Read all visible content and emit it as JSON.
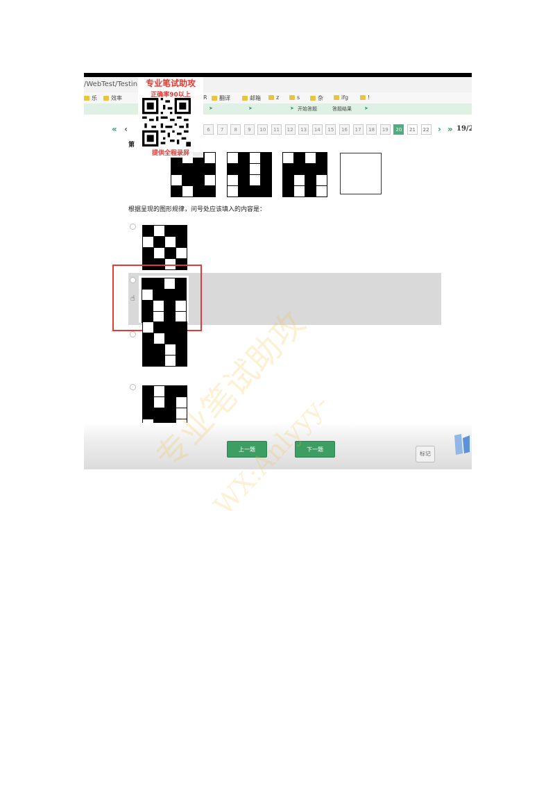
{
  "browser": {
    "url_fragment": "/WebTest/Testin",
    "bookmarks": [
      "乐",
      "效率",
      "R",
      "翻译",
      "邮箱",
      "z",
      "s",
      "杂",
      "ifg",
      "!"
    ]
  },
  "steps": {
    "items": [
      "开始答题",
      "答题结果"
    ]
  },
  "pager": {
    "pages": [
      "6",
      "7",
      "8",
      "9",
      "10",
      "11",
      "12",
      "13",
      "14",
      "15",
      "16",
      "17",
      "18",
      "19",
      "20",
      "21",
      "22"
    ],
    "current": "20",
    "counter": "19/2",
    "prefix": "第"
  },
  "promo": {
    "title": "专业笔试助攻",
    "line2": "正确率90以上",
    "line3": "提供全程录屏"
  },
  "question": {
    "text": "根据呈现的图形规律，问号处应该填入的内容是："
  },
  "buttons": {
    "prev": "上一题",
    "next": "下一题",
    "mark": "标记"
  },
  "watermark": {
    "line1": "专业笔试助攻",
    "line2": "WX:Anlyyy-"
  },
  "colors": {
    "accent": "#4caf7d",
    "highlight": "#e53935",
    "button": "#3d9e63"
  }
}
